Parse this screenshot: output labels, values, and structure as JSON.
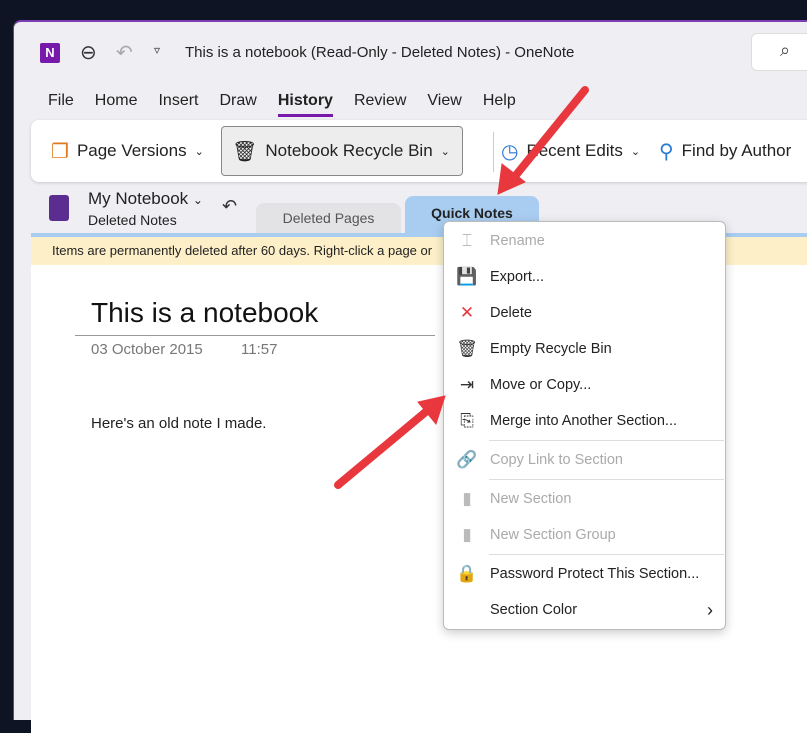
{
  "titlebar": {
    "title": "This is a notebook (Read-Only - Deleted Notes)  -  OneNote",
    "app_icon": "N"
  },
  "menubar": [
    "File",
    "Home",
    "Insert",
    "Draw",
    "History",
    "Review",
    "View",
    "Help"
  ],
  "ribbon": {
    "page_versions": "Page Versions",
    "recycle_bin": "Notebook Recycle Bin",
    "recent_edits": "Recent Edits",
    "find_by_author": "Find by Author"
  },
  "notebook": {
    "name": "My Notebook",
    "section": "Deleted Notes"
  },
  "tabs": [
    "Deleted Pages",
    "Quick Notes"
  ],
  "banner": "Items are permanently deleted after 60 days. Right-click a page or",
  "page": {
    "title": "This is a notebook",
    "date": "03 October 2015",
    "time": "11:57",
    "body": "Here's an old note I made."
  },
  "context_menu": [
    {
      "label": "Rename",
      "icon": "rename-icon",
      "disabled": true
    },
    {
      "label": "Export...",
      "icon": "export-icon",
      "disabled": false
    },
    {
      "label": "Delete",
      "icon": "delete-icon",
      "disabled": false
    },
    {
      "label": "Empty Recycle Bin",
      "icon": "trash-icon",
      "disabled": false
    },
    {
      "label": "Move or Copy...",
      "icon": "move-copy-icon",
      "disabled": false
    },
    {
      "label": "Merge into Another Section...",
      "icon": "merge-icon",
      "disabled": false
    },
    {
      "label": "Copy Link to Section",
      "icon": "link-icon",
      "disabled": true
    },
    {
      "label": "New Section",
      "icon": "new-section-icon",
      "disabled": true
    },
    {
      "label": "New Section Group",
      "icon": "new-section-group-icon",
      "disabled": true
    },
    {
      "label": "Password Protect This Section...",
      "icon": "lock-icon",
      "disabled": false
    },
    {
      "label": "Section Color",
      "icon": "none",
      "disabled": false
    }
  ],
  "colors": {
    "accent": "#7719aa",
    "tab_active": "#a9cdf1",
    "banner": "#fdf0c8",
    "annotation_arrow": "#e8383d"
  }
}
